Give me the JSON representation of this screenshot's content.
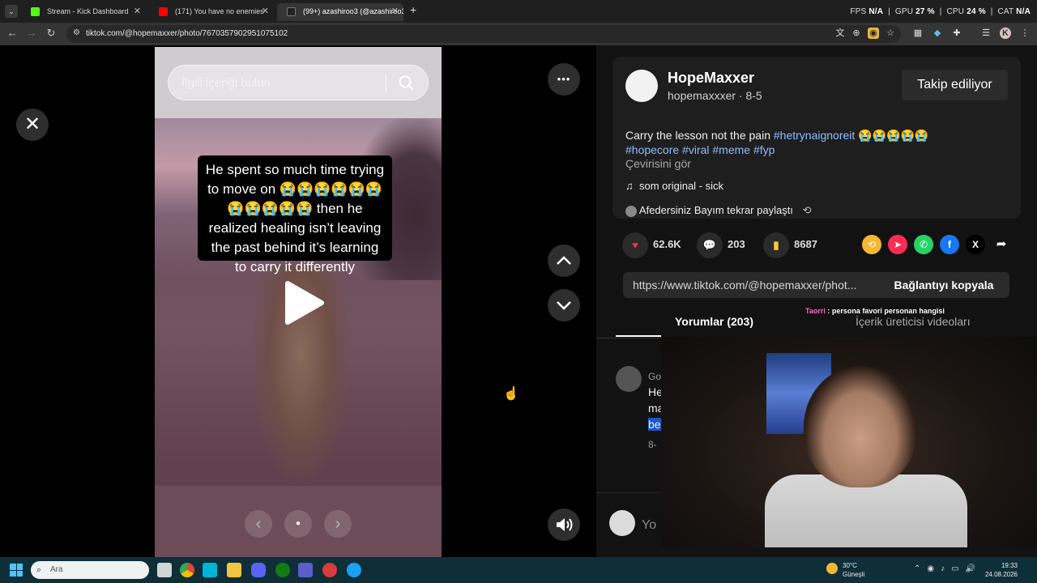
{
  "browser": {
    "tabs": [
      {
        "title": "Stream - Kick Dashboard",
        "color": "#53fc18"
      },
      {
        "title": "(171) You have no enemies",
        "color": "#ff0000"
      },
      {
        "title": "(99+) azashiroo3 (@azashiroo3)",
        "color": "#222222"
      }
    ],
    "new_tab": "+",
    "stats": {
      "fps_label": "FPS",
      "fps": "N/A",
      "gpu_label": "GPU",
      "gpu": "27 %",
      "cpu_label": "CPU",
      "cpu": "24 %",
      "cat_label": "CAT",
      "cat": "N/A"
    },
    "url": "tiktok.com/@hopemaxxer/photo/7670357902951075102",
    "profile_initial": "K"
  },
  "viewer": {
    "search_placeholder": "İlgili içeriği bulun",
    "caption": "He spent so much time trying to move on 😭😭😭😭😭😭😭😭😭😭😭 then he realized healing isn’t leaving the past behind it’s learning to carry it differently",
    "close_glyph": "✕",
    "more_glyph": "•••",
    "up_glyph": "⌃",
    "down_glyph": "⌄",
    "volume_glyph": "🔊",
    "prev_glyph": "‹",
    "next_glyph": "›",
    "dot_glyph": "●"
  },
  "post": {
    "display_name": "HopeMaxxer",
    "handle": "hopemaxxxer · 8-5",
    "follow_label": "Takip ediliyor",
    "description_text": "Carry the lesson not the pain",
    "tags_line1": "#hetrynaignoreit",
    "emojis": "😭😭😭😭😭",
    "tags_line2": "#hopecore #viral #meme #fyp",
    "translate_label": "Çevirisini gör",
    "music": "som original - sick",
    "repost_text": "Afedersiniz Bayım tekrar paylaştı",
    "likes": "62.6K",
    "comments": "203",
    "saves": "8687",
    "link": "https://www.tiktok.com/@hopemaxxer/phot...",
    "copy_link_label": "Bağlantıyı kopyala",
    "tab_comments": "Yorumlar (203)",
    "tab_creator": "İçerik üreticisi videoları",
    "chat_user": "Taorri",
    "chat_text": ": persona favori personan hangisi",
    "comment_name": "Go",
    "comment_line1": "He",
    "comment_line2": "ma",
    "comment_line3": "be",
    "comment_meta": "8-",
    "comment_input_placeholder": "Yo"
  },
  "taskbar": {
    "search_placeholder": "Ara",
    "temperature": "30°C",
    "weather": "Güneşli",
    "time": "19:33",
    "date": "24.08.2026"
  }
}
